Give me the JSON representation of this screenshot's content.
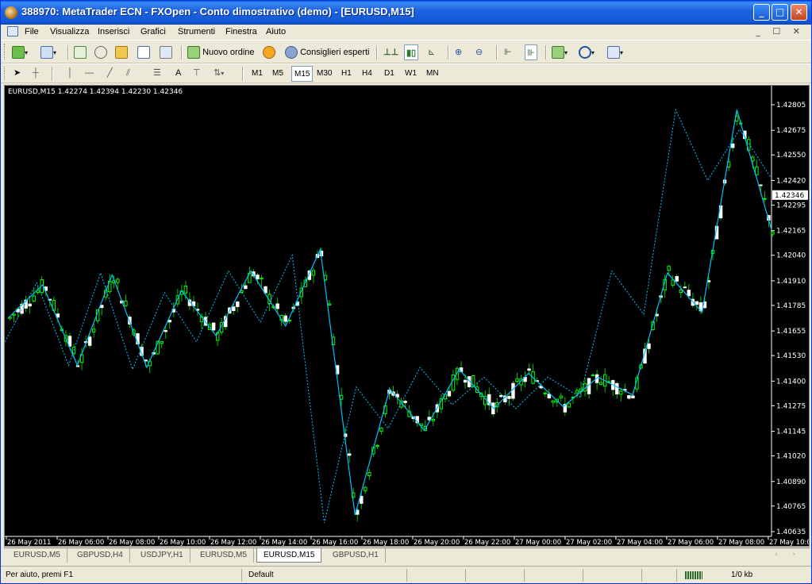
{
  "window": {
    "title": "388970: MetaTrader ECN - FXOpen - Conto dimostrativo (demo) - [EURUSD,M15]",
    "min_glyph": "_",
    "max_glyph": "□",
    "close_glyph": "✕"
  },
  "menu": {
    "items": [
      "File",
      "Visualizza",
      "Inserisci",
      "Grafici",
      "Strumenti",
      "Finestra",
      "Aiuto"
    ],
    "mdi_controls": "_ ☐ ✕"
  },
  "toolbar": {
    "new_order": "Nuovo ordine",
    "expert_advisors": "Consiglieri esperti",
    "text_tool": "A",
    "timeframes": [
      "M1",
      "M5",
      "M15",
      "M30",
      "H1",
      "H4",
      "D1",
      "W1",
      "MN"
    ],
    "active_timeframe": "M15"
  },
  "chart": {
    "info": "EURUSD,M15  1.42274 1.42394 1.42230 1.42346",
    "symbol": "EURUSD",
    "timeframe": "M15",
    "current_price_label": "1.42346",
    "colors": {
      "background": "#000000",
      "bull": "#00ff00",
      "bear": "#ffffff",
      "zigzag": "#00bfff",
      "axis": "#ffffff"
    }
  },
  "chart_data": {
    "type": "candlestick",
    "title": "EURUSD,M15",
    "ylim": [
      1.40635,
      1.42805
    ],
    "y_ticks": [
      "1.42805",
      "1.42675",
      "1.42550",
      "1.42420",
      "1.42295",
      "1.42165",
      "1.42040",
      "1.41910",
      "1.41785",
      "1.41655",
      "1.41530",
      "1.41400",
      "1.41275",
      "1.41145",
      "1.41020",
      "1.40890",
      "1.40765",
      "1.40635"
    ],
    "x_ticks": [
      "26 May 2011",
      "26 May 06:00",
      "26 May 08:00",
      "26 May 10:00",
      "26 May 12:00",
      "26 May 14:00",
      "26 May 16:00",
      "26 May 18:00",
      "26 May 20:00",
      "26 May 22:00",
      "27 May 00:00",
      "27 May 02:00",
      "27 May 04:00",
      "27 May 06:00",
      "27 May 08:00",
      "27 May 10:00"
    ],
    "zigzag_pivots": [
      1.416,
      1.419,
      1.4148,
      1.4195,
      1.4146,
      1.4185,
      1.416,
      1.4196,
      1.417,
      1.4204,
      1.4068,
      1.4137,
      1.4116,
      1.4147,
      1.4128,
      1.4142,
      1.4126,
      1.4142,
      1.4132,
      1.4196,
      1.4174,
      1.4278,
      1.4242,
      1.4268,
      1.4243
    ],
    "zigzag_solid": [
      1.4172,
      1.4189,
      1.4148,
      1.4194,
      1.4147,
      1.4186,
      1.4163,
      1.4196,
      1.4168,
      1.4207,
      1.4072,
      1.4136,
      1.4115,
      1.4146,
      1.4126,
      1.4144,
      1.4127,
      1.4142,
      1.4133,
      1.4195,
      1.4175,
      1.4278,
      1.4217
    ]
  },
  "tabs": {
    "items": [
      "EURUSD,M5",
      "GBPUSD,H4",
      "USDJPY,H1",
      "EURUSD,M5",
      "EURUSD,M15",
      "GBPUSD,H1"
    ],
    "active": "EURUSD,M15",
    "arrows": "‹ ›"
  },
  "status": {
    "help": "Per aiuto, premi F1",
    "profile": "Default",
    "traffic": "1/0 kb"
  }
}
